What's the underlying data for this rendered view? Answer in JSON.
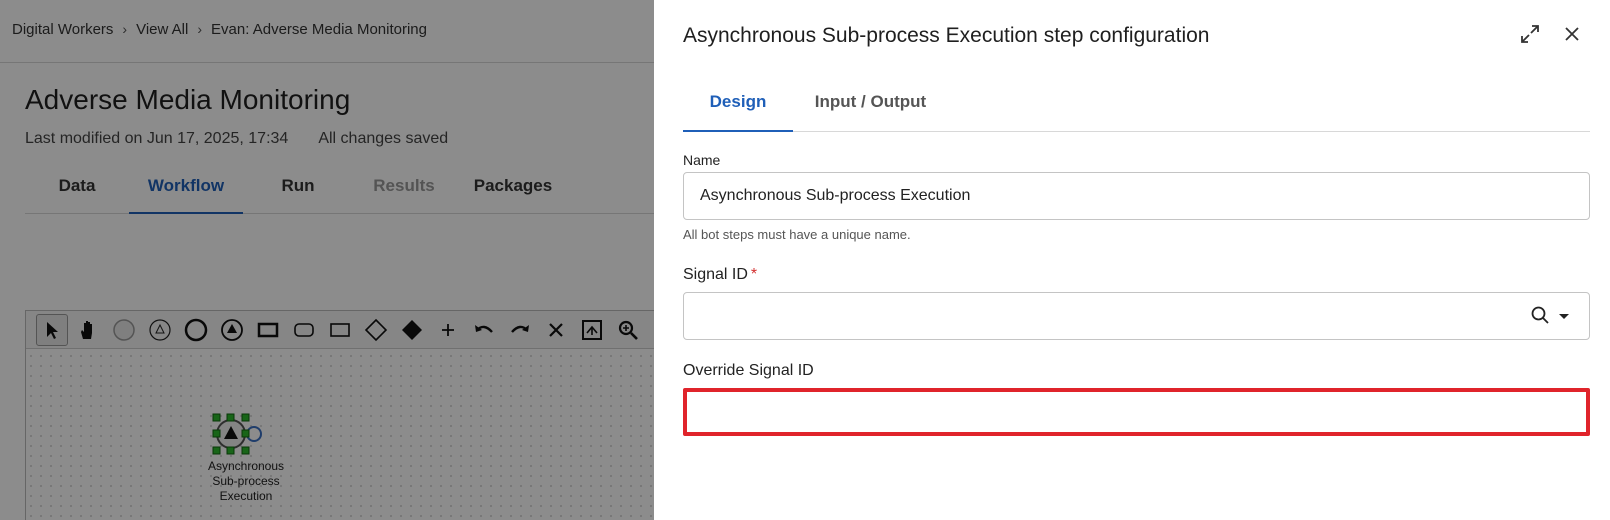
{
  "breadcrumb": [
    "Digital Workers",
    "View All",
    "Evan: Adverse Media Monitoring"
  ],
  "page": {
    "title": "Adverse Media Monitoring",
    "last_modified": "Last modified on Jun 17, 2025, 17:34",
    "save_status": "All changes saved",
    "tabs": [
      {
        "label": "Data",
        "state": "normal"
      },
      {
        "label": "Workflow",
        "state": "active"
      },
      {
        "label": "Run",
        "state": "normal"
      },
      {
        "label": "Results",
        "state": "disabled"
      },
      {
        "label": "Packages",
        "state": "normal"
      }
    ]
  },
  "canvas": {
    "toolbar_icons": [
      "pointer-icon",
      "hand-icon",
      "start-event-icon",
      "signal-start-event-icon",
      "end-event-icon",
      "signal-end-event-icon",
      "task-icon",
      "subprocess-icon",
      "collapsed-subprocess-icon",
      "gateway-icon",
      "exclusive-gateway-icon",
      "add-icon",
      "undo-icon",
      "redo-icon",
      "delete-icon",
      "fit-icon",
      "zoom-in-icon"
    ],
    "node_label_lines": [
      "Asynchronous",
      "Sub-process",
      "Execution"
    ]
  },
  "drawer": {
    "title": "Asynchronous Sub-process Execution step configuration",
    "tabs": [
      {
        "label": "Design",
        "state": "active"
      },
      {
        "label": "Input / Output",
        "state": "normal"
      }
    ],
    "name_field": {
      "label": "Name",
      "value": "Asynchronous Sub-process Execution",
      "helper": "All bot steps must have a unique name."
    },
    "signal_field": {
      "label": "Signal ID",
      "required_mark": "*",
      "value": ""
    },
    "override_field": {
      "label": "Override Signal ID",
      "value": ""
    }
  },
  "colors": {
    "accent": "#1f5fb8",
    "required": "#d32f2f",
    "highlight_border": "#e0242b",
    "overlay": "rgba(0,0,0,0.45)"
  }
}
